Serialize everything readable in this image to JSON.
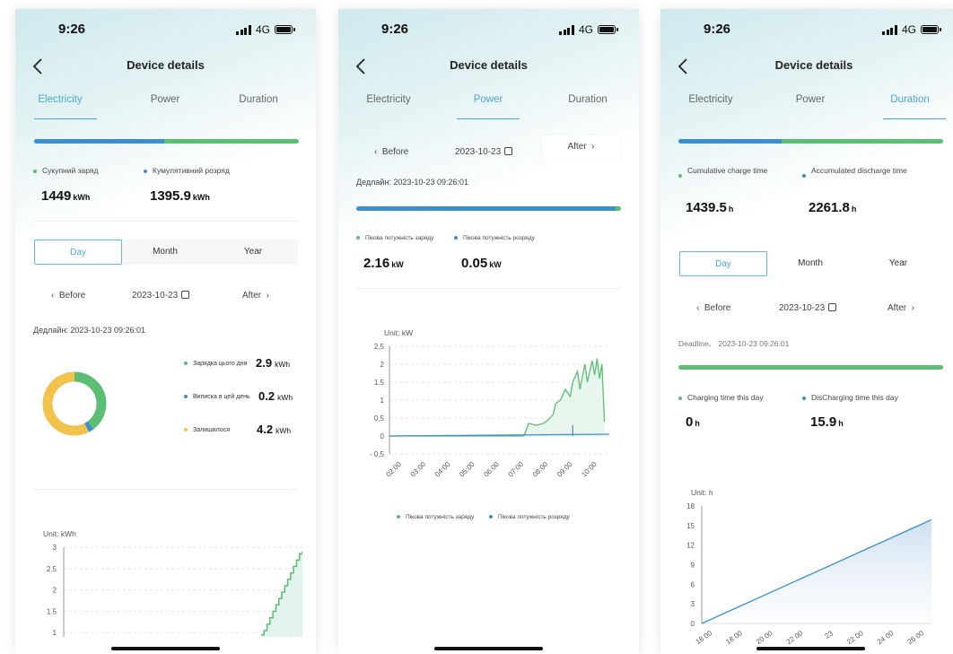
{
  "status": {
    "time": "9:26",
    "network": "4G"
  },
  "screens": [
    {
      "title": "Device details",
      "tabs": [
        "Electricity",
        "Power",
        "Duration"
      ],
      "active_tab": 0,
      "progress": {
        "blue_fraction": 0.49,
        "green_fraction": 0.51
      },
      "stats": [
        {
          "label": "Сукупний заряд",
          "value": "1449",
          "unit": "kWh",
          "color": "#5cbd74"
        },
        {
          "label": "Кумулятивний розряд",
          "value": "1395.9",
          "unit": "kWh",
          "color": "#3d8fc9"
        }
      ],
      "periods": [
        "Day",
        "Month",
        "Year"
      ],
      "active_period": 0,
      "date_nav": {
        "before": "Before",
        "date": "2023-10-23",
        "after": "After"
      },
      "deadline": "Дедлайн: 2023-10-23 09:26:01",
      "donut": {
        "items": [
          {
            "label": "Зарядка цього дня",
            "value": "2.9",
            "unit": "kWh",
            "color": "#5cbd74"
          },
          {
            "label": "Виписка в цей день",
            "value": "0.2",
            "unit": "kWh",
            "color": "#3d8fc9"
          },
          {
            "label": "Залишилося",
            "value": "4.2",
            "unit": "kWh",
            "color": "#f1c24c"
          }
        ]
      },
      "chart_unit": "Unit: kWh",
      "chart_data": {
        "type": "area",
        "ylabel": "Unit: kWh",
        "yticks": [
          "3",
          "2.5",
          "2",
          "1.5",
          "1"
        ],
        "ylim": [
          0.9,
          3
        ],
        "series": [
          {
            "values": [
              0.95,
              1.05,
              1.2,
              1.35,
              1.5,
              1.65,
              1.8,
              1.95,
              2.1,
              2.25,
              2.4,
              2.55,
              2.7,
              2.85,
              2.9
            ],
            "color": "#5cbd74"
          }
        ]
      }
    },
    {
      "title": "Device details",
      "tabs": [
        "Electricity",
        "Power",
        "Duration"
      ],
      "active_tab": 1,
      "date_nav": {
        "before": "Before",
        "date": "2023-10-23",
        "after": "After"
      },
      "deadline": "Дедлайн: 2023-10-23 09:26:01",
      "progress": {
        "blue_fraction": 0.98,
        "green_fraction": 0.02
      },
      "stats": [
        {
          "label": "Пікова потужність заряду",
          "value": "2.16",
          "unit": "kW",
          "color": "#5cbd74"
        },
        {
          "label": "Пікова потужність розряду",
          "value": "0.05",
          "unit": "kW",
          "color": "#3d8fc9"
        }
      ],
      "chart_unit": "Unit: kW",
      "chart_data": {
        "type": "line",
        "ylabel": "Unit: kW",
        "yticks": [
          "2.5",
          "2",
          "1.5",
          "1",
          "0,5",
          "0",
          "- 0,5"
        ],
        "ylim": [
          -0.5,
          2.5
        ],
        "x_labels": [
          "02:00",
          "03:00",
          "04:00",
          "05:00",
          "06:00",
          "07:00",
          "08:00",
          "09:00",
          "10:00"
        ],
        "x_range": [
          1.5,
          10.5
        ],
        "series": [
          {
            "name": "Пікова потужність заряду",
            "color": "#5cbd74",
            "points": [
              [
                1.5,
                0
              ],
              [
                7.0,
                0
              ],
              [
                7.2,
                0.35
              ],
              [
                7.5,
                0.3
              ],
              [
                7.8,
                0.35
              ],
              [
                8.0,
                0.45
              ],
              [
                8.2,
                0.6
              ],
              [
                8.3,
                0.9
              ],
              [
                8.5,
                1.0
              ],
              [
                8.7,
                1.3
              ],
              [
                8.9,
                1.1
              ],
              [
                9.0,
                1.5
              ],
              [
                9.2,
                1.8
              ],
              [
                9.3,
                1.3
              ],
              [
                9.5,
                2.0
              ],
              [
                9.6,
                1.5
              ],
              [
                9.8,
                2.1
              ],
              [
                9.9,
                1.7
              ],
              [
                10.0,
                2.16
              ],
              [
                10.1,
                1.6
              ],
              [
                10.2,
                2.0
              ],
              [
                10.3,
                0.4
              ]
            ]
          },
          {
            "name": "Пікова потужність розряду",
            "color": "#3d8fc9",
            "points": [
              [
                1.5,
                0
              ],
              [
                10.5,
                0.05
              ]
            ]
          }
        ]
      },
      "bottom_legend": [
        "Пікова потужність заряду",
        "Пікова потужність розряду"
      ]
    },
    {
      "title": "Device details",
      "tabs": [
        "Electricity",
        "Power",
        "Duration"
      ],
      "active_tab": 2,
      "progress": {
        "blue_fraction": 0.39,
        "green_fraction": 0.61
      },
      "stats": [
        {
          "label": "Cumulative charge time",
          "value": "1439.5",
          "unit": "h",
          "color": "#5cbd74"
        },
        {
          "label": "Accumulated discharge time",
          "value": "2261.8",
          "unit": "h",
          "color": "#3d8fc9"
        }
      ],
      "periods": [
        "Day",
        "Month",
        "Year"
      ],
      "active_period": 0,
      "date_nav": {
        "before": "Before",
        "date": "2023-10-23",
        "after": "After"
      },
      "deadline": "Deadline、 2023-10-23 09:26:01",
      "progress2": {
        "blue_fraction": 0.0,
        "green_fraction": 1.0
      },
      "day_stats": [
        {
          "label": "Charging time this day",
          "value": "0",
          "unit": "h",
          "color": "#5cbd74"
        },
        {
          "label": "DisCharging time this day",
          "value": "15.9",
          "unit": "h",
          "color": "#3d8fc9"
        }
      ],
      "chart_unit": "Unit: h",
      "chart_data": {
        "type": "area",
        "ylabel": "Unit: h",
        "yticks": [
          "18",
          "15",
          "12",
          "9",
          "6",
          "3",
          "0"
        ],
        "ylim": [
          0,
          18
        ],
        "x_labels": [
          "18 00",
          "18 00",
          "20 00",
          "22 00",
          "23",
          "22 00",
          "24 00",
          "26 00"
        ],
        "series": [
          {
            "values": [
              0,
              15.9
            ],
            "color": "#3d8fc9"
          }
        ]
      }
    }
  ]
}
